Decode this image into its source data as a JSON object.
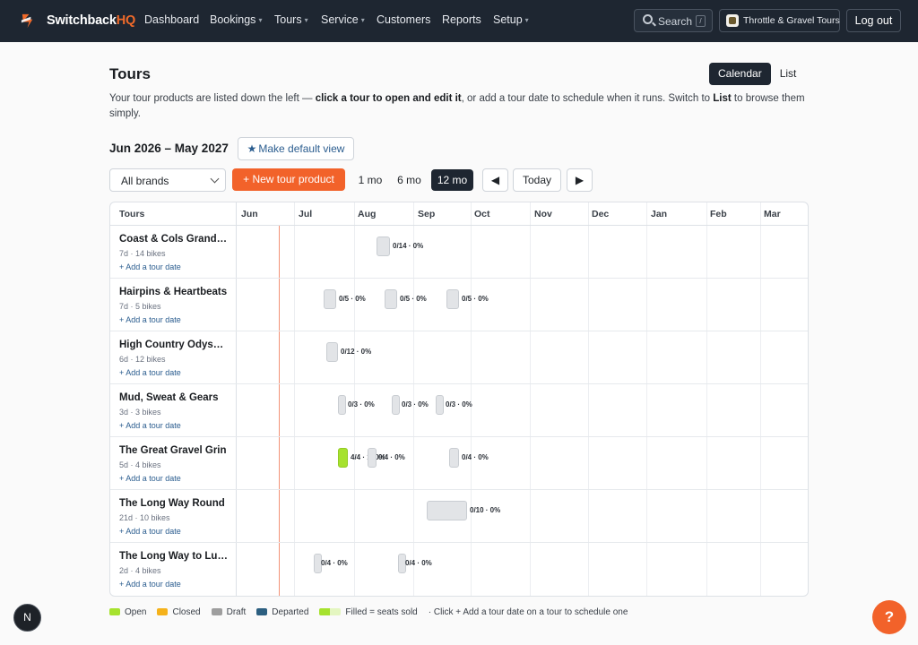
{
  "app": {
    "brand_main": "Switchback",
    "brand_accent": "HQ",
    "accent_color": "#f2622a",
    "nav_bg": "#1e2631"
  },
  "nav": {
    "items": [
      {
        "label": "Dashboard",
        "caret": false
      },
      {
        "label": "Bookings",
        "caret": true
      },
      {
        "label": "Tours",
        "caret": true
      },
      {
        "label": "Service",
        "caret": true
      },
      {
        "label": "Customers",
        "caret": false
      },
      {
        "label": "Reports",
        "caret": false
      },
      {
        "label": "Setup",
        "caret": true
      }
    ],
    "search_label": "Search",
    "search_shortcut": "/",
    "org_name": "Throttle & Gravel Tours",
    "logout_label": "Log out"
  },
  "page": {
    "title": "Tours",
    "view_tabs": [
      "Calendar",
      "List"
    ],
    "active_view": "Calendar",
    "intro_1": "Your tour products are listed down the left — ",
    "intro_bold_1": "click a tour to open and edit it",
    "intro_2": ", or add a tour date to schedule when it runs. Switch to ",
    "intro_bold_2": "List",
    "intro_3": " to browse them simply."
  },
  "toolbar": {
    "range_label": "Jun 2026 – May 2027",
    "default_view_label": "Make default view",
    "brand_filter": "All brands",
    "new_tour_label": "New tour product",
    "ranges": [
      "1 mo",
      "6 mo",
      "12 mo"
    ],
    "active_range": "12 mo",
    "prev_label": "◀",
    "today_label": "Today",
    "next_label": "▶"
  },
  "calendar": {
    "tours_header": "Tours",
    "months": [
      "Jun",
      "Jul",
      "Aug",
      "Sep",
      "Oct",
      "Nov",
      "Dec",
      "Jan",
      "Feb",
      "Mar"
    ],
    "add_date_label": "+ Add a tour date",
    "tours": [
      {
        "name": "Coast & Cols Grand Tour",
        "meta": "7d · 14 bikes",
        "dates": [
          {
            "label": "0/14 · 0%",
            "status": "draft"
          }
        ]
      },
      {
        "name": "Hairpins & Heartbeats",
        "meta": "7d · 5 bikes",
        "dates": [
          {
            "label": "0/5 · 0%",
            "status": "draft"
          },
          {
            "label": "0/5 · 0%",
            "status": "draft"
          },
          {
            "label": "0/5 · 0%",
            "status": "draft"
          }
        ]
      },
      {
        "name": "High Country Odyssey",
        "meta": "6d · 12 bikes",
        "dates": [
          {
            "label": "0/12 · 0%",
            "status": "draft"
          }
        ]
      },
      {
        "name": "Mud, Sweat & Gears",
        "meta": "3d · 3 bikes",
        "dates": [
          {
            "label": "0/3 · 0%",
            "status": "draft"
          },
          {
            "label": "0/3 · 0%",
            "status": "draft"
          },
          {
            "label": "0/3 · 0%",
            "status": "draft"
          }
        ]
      },
      {
        "name": "The Great Gravel Grin",
        "meta": "5d · 4 bikes",
        "dates": [
          {
            "label": "4/4 · 100%",
            "status": "open"
          },
          {
            "label": "0/4 · 0%",
            "status": "draft"
          },
          {
            "label": "0/4 · 0%",
            "status": "draft"
          }
        ]
      },
      {
        "name": "The Long Way Round",
        "meta": "21d · 10 bikes",
        "dates": [
          {
            "label": "0/10 · 0%",
            "status": "draft"
          }
        ]
      },
      {
        "name": "The Long Way to Lunch",
        "meta": "2d · 4 bikes",
        "dates": [
          {
            "label": "0/4 · 0%",
            "status": "draft"
          },
          {
            "label": "0/4 · 0%",
            "status": "draft"
          }
        ]
      }
    ]
  },
  "legend": {
    "items": [
      {
        "label": "Open",
        "color": "#a6e22e"
      },
      {
        "label": "Closed",
        "color": "#f5b21b"
      },
      {
        "label": "Draft",
        "color": "#9e9e9e"
      },
      {
        "label": "Departed",
        "color": "#2c5f80"
      },
      {
        "label": "Filled = seats sold",
        "color": "#a6e22e"
      }
    ],
    "hint": "· Click + Add a tour date on a tour to schedule one"
  },
  "widgets": {
    "dev_badge": "N",
    "help": "?"
  }
}
